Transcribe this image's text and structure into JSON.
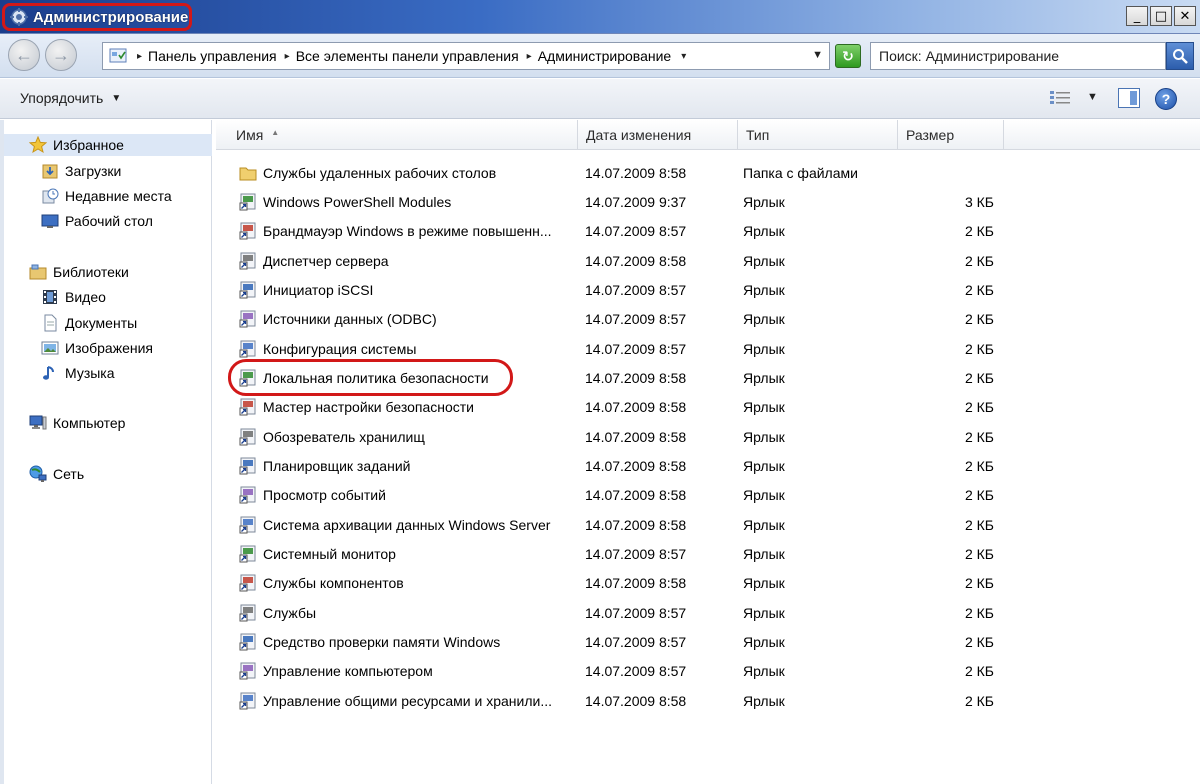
{
  "window": {
    "title": "Администрирование",
    "controls": {
      "minimize": "_",
      "maximize": "□",
      "close": "✕"
    }
  },
  "address": {
    "breadcrumbs": [
      "Панель управления",
      "Все элементы панели управления",
      "Администрирование"
    ],
    "search_placeholder": "Поиск: Администрирование"
  },
  "toolbar": {
    "organize_label": "Упорядочить"
  },
  "sidebar": {
    "favorites": {
      "label": "Избранное",
      "items": [
        {
          "label": "Загрузки",
          "icon": "downloads-icon"
        },
        {
          "label": "Недавние места",
          "icon": "recent-places-icon"
        },
        {
          "label": "Рабочий стол",
          "icon": "desktop-icon"
        }
      ]
    },
    "libraries": {
      "label": "Библиотеки",
      "items": [
        {
          "label": "Видео",
          "icon": "video-icon"
        },
        {
          "label": "Документы",
          "icon": "documents-icon"
        },
        {
          "label": "Изображения",
          "icon": "pictures-icon"
        },
        {
          "label": "Музыка",
          "icon": "music-icon"
        }
      ]
    },
    "computer": {
      "label": "Компьютер"
    },
    "network": {
      "label": "Сеть"
    }
  },
  "columns": {
    "name": "Имя",
    "date": "Дата изменения",
    "type": "Тип",
    "size": "Размер"
  },
  "files": [
    {
      "name": "Службы удаленных рабочих столов",
      "date": "14.07.2009 8:58",
      "type": "Папка с файлами",
      "size": "",
      "icon": "folder-icon"
    },
    {
      "name": "Windows PowerShell Modules",
      "date": "14.07.2009 9:37",
      "type": "Ярлык",
      "size": "3 КБ",
      "icon": "shortcut-icon"
    },
    {
      "name": "Брандмауэр Windows в режиме повышенн...",
      "date": "14.07.2009 8:57",
      "type": "Ярлык",
      "size": "2 КБ",
      "icon": "firewall-shortcut-icon"
    },
    {
      "name": "Диспетчер сервера",
      "date": "14.07.2009 8:58",
      "type": "Ярлык",
      "size": "2 КБ",
      "icon": "server-manager-shortcut-icon"
    },
    {
      "name": "Инициатор iSCSI",
      "date": "14.07.2009 8:57",
      "type": "Ярлык",
      "size": "2 КБ",
      "icon": "iscsi-shortcut-icon"
    },
    {
      "name": "Источники данных (ODBC)",
      "date": "14.07.2009 8:57",
      "type": "Ярлык",
      "size": "2 КБ",
      "icon": "odbc-shortcut-icon"
    },
    {
      "name": "Конфигурация системы",
      "date": "14.07.2009 8:57",
      "type": "Ярлык",
      "size": "2 КБ",
      "icon": "msconfig-shortcut-icon"
    },
    {
      "name": "Локальная политика безопасности",
      "date": "14.07.2009 8:58",
      "type": "Ярлык",
      "size": "2 КБ",
      "icon": "security-policy-shortcut-icon"
    },
    {
      "name": "Мастер настройки безопасности",
      "date": "14.07.2009 8:58",
      "type": "Ярлык",
      "size": "2 КБ",
      "icon": "security-wizard-shortcut-icon"
    },
    {
      "name": "Обозреватель хранилищ",
      "date": "14.07.2009 8:58",
      "type": "Ярлык",
      "size": "2 КБ",
      "icon": "storage-explorer-shortcut-icon"
    },
    {
      "name": "Планировщик заданий",
      "date": "14.07.2009 8:58",
      "type": "Ярлык",
      "size": "2 КБ",
      "icon": "task-scheduler-shortcut-icon"
    },
    {
      "name": "Просмотр событий",
      "date": "14.07.2009 8:58",
      "type": "Ярлык",
      "size": "2 КБ",
      "icon": "event-viewer-shortcut-icon"
    },
    {
      "name": "Система архивации данных Windows Server",
      "date": "14.07.2009 8:58",
      "type": "Ярлык",
      "size": "2 КБ",
      "icon": "backup-shortcut-icon"
    },
    {
      "name": "Системный монитор",
      "date": "14.07.2009 8:57",
      "type": "Ярлык",
      "size": "2 КБ",
      "icon": "perfmon-shortcut-icon"
    },
    {
      "name": "Службы компонентов",
      "date": "14.07.2009 8:58",
      "type": "Ярлык",
      "size": "2 КБ",
      "icon": "component-services-shortcut-icon"
    },
    {
      "name": "Службы",
      "date": "14.07.2009 8:57",
      "type": "Ярлык",
      "size": "2 КБ",
      "icon": "services-shortcut-icon"
    },
    {
      "name": "Средство проверки памяти Windows",
      "date": "14.07.2009 8:57",
      "type": "Ярлык",
      "size": "2 КБ",
      "icon": "memory-diagnostic-shortcut-icon"
    },
    {
      "name": "Управление компьютером",
      "date": "14.07.2009 8:57",
      "type": "Ярлык",
      "size": "2 КБ",
      "icon": "computer-management-shortcut-icon"
    },
    {
      "name": "Управление общими ресурсами и хранили...",
      "date": "14.07.2009 8:58",
      "type": "Ярлык",
      "size": "2 КБ",
      "icon": "share-storage-shortcut-icon"
    }
  ],
  "highlighted_file": "Локальная политика безопасности",
  "colors": {
    "title_gradient_start": "#1a3d8c",
    "highlight_ring": "#d21818",
    "selected_nav_bg": "#dce7f6"
  }
}
